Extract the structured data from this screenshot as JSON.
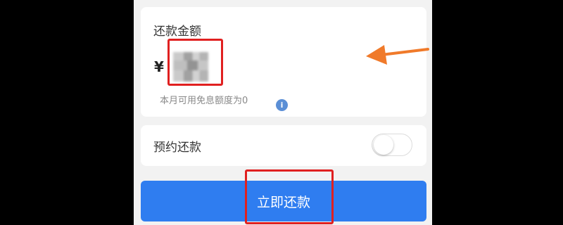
{
  "repay_card": {
    "title": "还款金额",
    "currency_symbol": "¥",
    "amount": "",
    "interest_free_note": "本月可用免息额度为0",
    "info_icon_glyph": "i"
  },
  "schedule": {
    "label": "预约还款",
    "toggle_on": false
  },
  "action": {
    "pay_now_label": "立即还款"
  },
  "colors": {
    "primary_button": "#2f7df0",
    "highlight_box": "#e02020",
    "arrow": "#f07a2a",
    "info_icon": "#5b8fd6"
  },
  "icons": [
    "info-icon",
    "toggle-switch",
    "annotation-arrow"
  ]
}
